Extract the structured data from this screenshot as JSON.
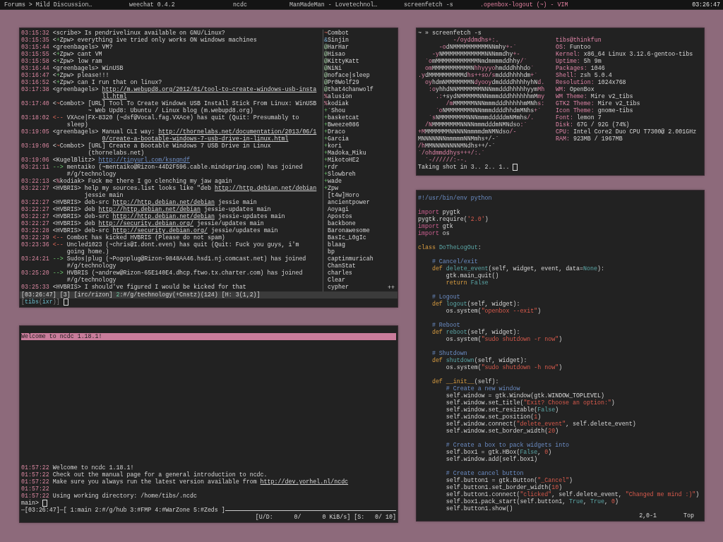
{
  "taskbar": {
    "tasks": [
      {
        "title": "Forums > Mild Discussion…",
        "selected": false
      },
      {
        "title": "weechat 0.4.2",
        "selected": false
      },
      {
        "title": "ncdc",
        "selected": false
      },
      {
        "title": "ManMadeMan - Lovetechnol…",
        "selected": false
      },
      {
        "title": "screenfetch -s",
        "selected": false
      },
      {
        "title": ".openbox-logout (~) - VIM",
        "selected": true
      }
    ],
    "clock": "03:26:47"
  },
  "weechat": {
    "messages": [
      {
        "time": "03:15:32",
        "prefix": [
          {
            "kind": "plain",
            "text": "<scribe>"
          }
        ],
        "lines": [
          [
            {
              "kind": "plain",
              "text": "Is pendrivelinux available on GNU/Linux?"
            }
          ]
        ]
      },
      {
        "time": "03:15:35",
        "prefix": [
          {
            "kind": "plain",
            "text": "<"
          },
          {
            "kind": "voice",
            "text": "+"
          },
          {
            "kind": "plain",
            "text": "Zpw>"
          }
        ],
        "lines": [
          [
            {
              "kind": "plain",
              "text": "everything ive tried only works ON windows machines"
            }
          ]
        ]
      },
      {
        "time": "03:15:44",
        "prefix": [
          {
            "kind": "plain",
            "text": "<greenbagels>"
          }
        ],
        "lines": [
          [
            {
              "kind": "plain",
              "text": "VM?"
            }
          ]
        ]
      },
      {
        "time": "03:15:55",
        "prefix": [
          {
            "kind": "plain",
            "text": "<"
          },
          {
            "kind": "voice",
            "text": "+"
          },
          {
            "kind": "plain",
            "text": "Zpw>"
          }
        ],
        "lines": [
          [
            {
              "kind": "plain",
              "text": "cant VM"
            }
          ]
        ]
      },
      {
        "time": "03:15:58",
        "prefix": [
          {
            "kind": "plain",
            "text": "<"
          },
          {
            "kind": "voice",
            "text": "+"
          },
          {
            "kind": "plain",
            "text": "Zpw>"
          }
        ],
        "lines": [
          [
            {
              "kind": "plain",
              "text": "low ram"
            }
          ]
        ]
      },
      {
        "time": "03:16:44",
        "prefix": [
          {
            "kind": "plain",
            "text": "<greenbagels>"
          }
        ],
        "lines": [
          [
            {
              "kind": "plain",
              "text": "WinUSB"
            }
          ]
        ]
      },
      {
        "time": "03:16:47",
        "prefix": [
          {
            "kind": "plain",
            "text": "<"
          },
          {
            "kind": "voice",
            "text": "+"
          },
          {
            "kind": "plain",
            "text": "Zpw>"
          }
        ],
        "lines": [
          [
            {
              "kind": "plain",
              "text": "please!!!"
            }
          ]
        ]
      },
      {
        "time": "03:16:52",
        "prefix": [
          {
            "kind": "plain",
            "text": "<"
          },
          {
            "kind": "voice",
            "text": "+"
          },
          {
            "kind": "plain",
            "text": "Zpw>"
          }
        ],
        "lines": [
          [
            {
              "kind": "plain",
              "text": "can I run that on linux?"
            }
          ]
        ]
      },
      {
        "time": "03:17:38",
        "prefix": [
          {
            "kind": "plain",
            "text": "<greenbagels>"
          }
        ],
        "lines": [
          [
            {
              "kind": "link",
              "text": "http://m.webupd8.org/2012/01/tool-to-create-windows-usb-insta"
            }
          ],
          [
            {
              "kind": "link",
              "text": "ll.html"
            }
          ]
        ]
      },
      {
        "time": "03:17:40",
        "prefix": [
          {
            "kind": "plain",
            "text": "<"
          },
          {
            "kind": "owner",
            "text": "~"
          },
          {
            "kind": "plain",
            "text": "Combot>"
          }
        ],
        "lines": [
          [
            {
              "kind": "plain",
              "text": "[URL] Tool To Create Windows USB Install Stick From Linux: WinUSB"
            }
          ],
          [
            {
              "kind": "plain",
              "text": "~ Web Upd8: Ubuntu / Linux blog (m.webupd8.org)"
            }
          ]
        ]
      },
      {
        "time": "03:18:02",
        "prefix": [
          {
            "kind": "quit",
            "text": "<--"
          }
        ],
        "lines": [
          [
            {
              "kind": "plain",
              "text": "VXAce|FX-8320 (~dsf@Vocal.fag.VXAce) has quit (Quit: Presumably to"
            }
          ],
          [
            {
              "kind": "plain",
              "text": "sleep)"
            }
          ]
        ]
      },
      {
        "time": "03:19:05",
        "prefix": [
          {
            "kind": "plain",
            "text": "<greenbagels>"
          }
        ],
        "lines": [
          [
            {
              "kind": "plain",
              "text": "Manual CLI way: "
            },
            {
              "kind": "link",
              "text": "http://thornelabs.net/documentation/2013/06/1"
            }
          ],
          [
            {
              "kind": "link",
              "text": "0/create-a-bootable-windows-7-usb-drive-in-linux.html"
            }
          ]
        ]
      },
      {
        "time": "03:19:06",
        "prefix": [
          {
            "kind": "plain",
            "text": "<"
          },
          {
            "kind": "owner",
            "text": "~"
          },
          {
            "kind": "plain",
            "text": "Combot>"
          }
        ],
        "lines": [
          [
            {
              "kind": "plain",
              "text": "[URL] Create a Bootable Windows 7 USB Drive in Linux"
            }
          ],
          [
            {
              "kind": "plain",
              "text": "(thornelabs.net)"
            }
          ]
        ]
      },
      {
        "time": "03:19:06",
        "prefix": [
          {
            "kind": "plain",
            "text": "<KugelBlitz>"
          }
        ],
        "lines": [
          [
            {
              "kind": "url",
              "text": "http://tinyurl.com/ksngndf"
            }
          ]
        ]
      },
      {
        "time": "03:21:11",
        "prefix": [
          {
            "kind": "join",
            "text": "-->"
          }
        ],
        "lines": [
          [
            {
              "kind": "plain",
              "text": "mentaiko (~mentaiko@Rizon-44D2F596.cable.mindspring.com) has joined"
            }
          ],
          [
            {
              "kind": "plain",
              "text": "#/g/technology"
            }
          ]
        ]
      },
      {
        "time": "03:22:13",
        "prefix": [
          {
            "kind": "plain",
            "text": "<"
          },
          {
            "kind": "halfop",
            "text": "%"
          },
          {
            "kind": "plain",
            "text": "kodiak>"
          }
        ],
        "lines": [
          [
            {
              "kind": "plain",
              "text": "Fuck me there I go clenching my jaw again"
            }
          ]
        ]
      },
      {
        "time": "03:22:27",
        "prefix": [
          {
            "kind": "plain",
            "text": "<HVBRIS>"
          }
        ],
        "lines": [
          [
            {
              "kind": "plain",
              "text": "help my sources.list looks like \"deb "
            },
            {
              "kind": "link",
              "text": "http://http.debian.net/debian"
            }
          ],
          [
            {
              "kind": "plain",
              "text": "jessie main"
            }
          ]
        ]
      },
      {
        "time": "03:22:27",
        "prefix": [
          {
            "kind": "plain",
            "text": "<HVBRIS>"
          }
        ],
        "lines": [
          [
            {
              "kind": "plain",
              "text": "deb-src "
            },
            {
              "kind": "link",
              "text": "http://http.debian.net/debian"
            },
            {
              "kind": "plain",
              "text": " jessie main"
            }
          ]
        ]
      },
      {
        "time": "03:22:27",
        "prefix": [
          {
            "kind": "plain",
            "text": "<HVBRIS>"
          }
        ],
        "lines": [
          [
            {
              "kind": "plain",
              "text": "deb "
            },
            {
              "kind": "link",
              "text": "http://http.debian.net/debian"
            },
            {
              "kind": "plain",
              "text": " jessie-updates main"
            }
          ]
        ]
      },
      {
        "time": "03:22:27",
        "prefix": [
          {
            "kind": "plain",
            "text": "<HVBRIS>"
          }
        ],
        "lines": [
          [
            {
              "kind": "plain",
              "text": "deb-src "
            },
            {
              "kind": "link",
              "text": "http://http.debian.net/debian"
            },
            {
              "kind": "plain",
              "text": " jessie-updates main"
            }
          ]
        ]
      },
      {
        "time": "03:22:27",
        "prefix": [
          {
            "kind": "plain",
            "text": "<HVBRIS>"
          }
        ],
        "lines": [
          [
            {
              "kind": "plain",
              "text": "deb "
            },
            {
              "kind": "link",
              "text": "http://security.debian.org/"
            },
            {
              "kind": "plain",
              "text": " jessie/updates main"
            }
          ]
        ]
      },
      {
        "time": "03:22:28",
        "prefix": [
          {
            "kind": "plain",
            "text": "<HVBRIS>"
          }
        ],
        "lines": [
          [
            {
              "kind": "plain",
              "text": "deb-src "
            },
            {
              "kind": "link",
              "text": "http://security.debian.org/"
            },
            {
              "kind": "plain",
              "text": " jessie/updates main"
            }
          ]
        ]
      },
      {
        "time": "03:22:29",
        "prefix": [
          {
            "kind": "quit",
            "text": "<--"
          }
        ],
        "lines": [
          [
            {
              "kind": "plain",
              "text": "Combot has kicked HVBRIS (Please do not spam)"
            }
          ]
        ]
      },
      {
        "time": "03:23:36",
        "prefix": [
          {
            "kind": "quit",
            "text": "<--"
          }
        ],
        "lines": [
          [
            {
              "kind": "plain",
              "text": "Uncled1023 (~chris@I.dont.even) has quit (Quit: Fuck you guys, i'm"
            }
          ],
          [
            {
              "kind": "plain",
              "text": "going home.)"
            }
          ]
        ]
      },
      {
        "time": "03:24:21",
        "prefix": [
          {
            "kind": "join",
            "text": "-->"
          }
        ],
        "lines": [
          [
            {
              "kind": "plain",
              "text": "Sudos|plug (~Pogoplug@Rizon-9848AA46.hsd1.nj.comcast.net) has joined"
            }
          ],
          [
            {
              "kind": "plain",
              "text": "#/g/technology"
            }
          ]
        ]
      },
      {
        "time": "03:25:20",
        "prefix": [
          {
            "kind": "join",
            "text": "-->"
          }
        ],
        "lines": [
          [
            {
              "kind": "plain",
              "text": "HVBRIS (~andrew@Rizon-65E140E4.dhcp.ftwo.tx.charter.com) has joined"
            }
          ],
          [
            {
              "kind": "plain",
              "text": "#/g/technology"
            }
          ]
        ]
      },
      {
        "time": "03:25:33",
        "prefix": [
          {
            "kind": "plain",
            "text": "<HVBRIS>"
          }
        ],
        "lines": [
          [
            {
              "kind": "plain",
              "text": "I should've figured I would be kicked for that"
            }
          ]
        ]
      }
    ],
    "nicklist": [
      {
        "kind": "owner",
        "prefix": "~",
        "nick": "Combot"
      },
      {
        "kind": "admin",
        "prefix": "&",
        "nick": "Sinjin"
      },
      {
        "kind": "op",
        "prefix": "@",
        "nick": "HarHar"
      },
      {
        "kind": "op",
        "prefix": "@",
        "nick": "Hisao"
      },
      {
        "kind": "op",
        "prefix": "@",
        "nick": "KittyKatt"
      },
      {
        "kind": "op",
        "prefix": "@",
        "nick": "NiNi"
      },
      {
        "kind": "op",
        "prefix": "@",
        "nick": "noface|sleep"
      },
      {
        "kind": "op",
        "prefix": "@",
        "nick": "Pr0Wolf29"
      },
      {
        "kind": "op",
        "prefix": "@",
        "nick": "that4chanwolf"
      },
      {
        "kind": "halfop",
        "prefix": "%",
        "nick": "alusion"
      },
      {
        "kind": "halfop",
        "prefix": "%",
        "nick": "kodiak"
      },
      {
        "kind": "voice",
        "prefix": "+",
        "nick": "`Shou"
      },
      {
        "kind": "voice",
        "prefix": "+",
        "nick": "basketcat"
      },
      {
        "kind": "voice",
        "prefix": "+",
        "nick": "Bweeze086"
      },
      {
        "kind": "voice",
        "prefix": "+",
        "nick": "Draco"
      },
      {
        "kind": "voice",
        "prefix": "+",
        "nick": "Garcia"
      },
      {
        "kind": "voice",
        "prefix": "+",
        "nick": "kori"
      },
      {
        "kind": "voice",
        "prefix": "+",
        "nick": "Madoka_Miku"
      },
      {
        "kind": "voice",
        "prefix": "+",
        "nick": "MikotoHE2"
      },
      {
        "kind": "voice",
        "prefix": "+",
        "nick": "rdr"
      },
      {
        "kind": "voice",
        "prefix": "+",
        "nick": "Slowbreh"
      },
      {
        "kind": "voice",
        "prefix": "+",
        "nick": "wade"
      },
      {
        "kind": "voice",
        "prefix": "+",
        "nick": "Zpw"
      },
      {
        "kind": "regular",
        "nick": "[t4w]Horo"
      },
      {
        "kind": "regular",
        "nick": "ancientpower"
      },
      {
        "kind": "regular",
        "nick": "Aoyagi"
      },
      {
        "kind": "regular",
        "nick": "Apostos"
      },
      {
        "kind": "regular",
        "nick": "backbone"
      },
      {
        "kind": "regular",
        "nick": "Baronawesome"
      },
      {
        "kind": "regular",
        "nick": "BasIc_L0gIc"
      },
      {
        "kind": "regular",
        "nick": "blaag"
      },
      {
        "kind": "regular",
        "nick": "bp"
      },
      {
        "kind": "regular",
        "nick": "captinmuricah"
      },
      {
        "kind": "regular",
        "nick": "ChanStat"
      },
      {
        "kind": "regular",
        "nick": "charles"
      },
      {
        "kind": "regular",
        "nick": "Clear"
      },
      {
        "kind": "regular",
        "nick": "cypher"
      }
    ],
    "nicklist_more": "++",
    "status_bar": [
      {
        "kind": "plain",
        "text": "[03:26:47] [3] [irc/rizon] "
      },
      {
        "kind": "channel",
        "text": "2"
      },
      {
        "kind": "plain",
        "text": ":#/g/technology(+Cnstz)(124) [H: 3(1,2)]"
      }
    ],
    "input_prompt": [
      {
        "kind": "dim",
        "text": "["
      },
      {
        "kind": "user",
        "text": "tibs"
      },
      {
        "kind": "dim",
        "text": "("
      },
      {
        "kind": "user",
        "text": "ixr"
      },
      {
        "kind": "dim",
        "text": ")]"
      }
    ]
  },
  "ncdc": {
    "title": "Welcome to ncdc 1.18.1!",
    "log": [
      {
        "time": "01:57:22",
        "spans": [
          {
            "kind": "plain",
            "text": "Welcome to ncdc 1.18.1!"
          }
        ]
      },
      {
        "time": "01:57:22",
        "spans": [
          {
            "kind": "plain",
            "text": "Check out the manual page for a general introduction to ncdc."
          }
        ]
      },
      {
        "time": "01:57:22",
        "spans": [
          {
            "kind": "plain",
            "text": "Make sure you always run the latest version available from "
          },
          {
            "kind": "link",
            "text": "http://dev.yorhel.nl/ncdc"
          }
        ]
      },
      {
        "time": "01:57:22"
      },
      {
        "time": "01:57:22",
        "spans": [
          {
            "kind": "plain",
            "text": "Using working directory: /home/tibs/.ncdc"
          }
        ]
      }
    ],
    "prompt": "main>",
    "window_list": "─[03:26:47]─[ 1:main 2:#/g/hub 3:#FMP 4:#WarZone 5:#Zeds ]",
    "transfer_status": "[U/D:      0/      0 KiB/s] [S:   0/ 10]"
  },
  "screenfetch": {
    "command": "~ » screenfetch -s",
    "art": [
      [
        {
          "kind": "accent",
          "text": "          -/oyddmdhs+:."
        }
      ],
      [
        {
          "kind": "accent",
          "text": "      -o"
        },
        {
          "kind": "plain",
          "text": "dNMMMMMMMMMMNNmhy"
        },
        {
          "kind": "accent",
          "text": "+-`"
        }
      ],
      [
        {
          "kind": "accent",
          "text": "    -y"
        },
        {
          "kind": "plain",
          "text": "NMMMMMMMMMMMMNNNmmdhy"
        },
        {
          "kind": "accent",
          "text": "+-"
        }
      ],
      [
        {
          "kind": "accent",
          "text": "  `o"
        },
        {
          "kind": "plain",
          "text": "mMMMMMMMMMMMMNmdmmmmddhhy"
        },
        {
          "kind": "accent",
          "text": "/`"
        }
      ],
      [
        {
          "kind": "accent",
          "text": "  om"
        },
        {
          "kind": "plain",
          "text": "MMMMMMMMMMMN"
        },
        {
          "kind": "accent",
          "text": "hhyyyo"
        },
        {
          "kind": "plain",
          "text": "hmdddhhhdo"
        },
        {
          "kind": "accent",
          "text": "`"
        }
      ],
      [
        {
          "kind": "accent",
          "text": ".y"
        },
        {
          "kind": "plain",
          "text": "dMMMMMMMMMMd"
        },
        {
          "kind": "accent",
          "text": "hs++so/s"
        },
        {
          "kind": "plain",
          "text": "mdddhhhhdm"
        },
        {
          "kind": "accent",
          "text": "+`"
        }
      ],
      [
        {
          "kind": "accent",
          "text": "  oy"
        },
        {
          "kind": "plain",
          "text": "hdmNMMMMMMMN"
        },
        {
          "kind": "accent",
          "text": "dyooy"
        },
        {
          "kind": "plain",
          "text": "dmddddhhhhyhN"
        },
        {
          "kind": "accent",
          "text": "d."
        }
      ],
      [
        {
          "kind": "accent",
          "text": "   :o"
        },
        {
          "kind": "plain",
          "text": "yhhdNNMMMMMMMNNNmmdddhhhhhyym"
        },
        {
          "kind": "accent",
          "text": "Mh"
        }
      ],
      [
        {
          "kind": "accent",
          "text": "     .:"
        },
        {
          "kind": "plain",
          "text": "+sydNMMMMMNNNmmmdddhhhhhhmM"
        },
        {
          "kind": "accent",
          "text": "my"
        }
      ],
      [
        {
          "kind": "accent",
          "text": "        /m"
        },
        {
          "kind": "plain",
          "text": "MMMMMMNNNmmmdddhhhhhmMNh"
        },
        {
          "kind": "accent",
          "text": "s:"
        }
      ],
      [
        {
          "kind": "accent",
          "text": "     `o"
        },
        {
          "kind": "plain",
          "text": "NMMMMMMMNNNmmmddddhhdmMNhs"
        },
        {
          "kind": "accent",
          "text": "+`"
        }
      ],
      [
        {
          "kind": "accent",
          "text": "   `s"
        },
        {
          "kind": "plain",
          "text": "NMMMMMMMMNNNmmmdddddmNMmhs"
        },
        {
          "kind": "accent",
          "text": "/."
        }
      ],
      [
        {
          "kind": "accent",
          "text": "  /N"
        },
        {
          "kind": "plain",
          "text": "MMMMMMMMNNNNmmmdddmNMNdso"
        },
        {
          "kind": "accent",
          "text": ":`"
        }
      ],
      [
        {
          "kind": "accent",
          "text": "+M"
        },
        {
          "kind": "plain",
          "text": "MMMMMMMNNNNNmmmmdmNMNdso"
        },
        {
          "kind": "accent",
          "text": "/-"
        }
      ],
      [
        {
          "kind": "plain",
          "text": "MNNNNNNNmmmmmNNMmhs+/-`"
        }
      ],
      [
        {
          "kind": "accent",
          "text": "/h"
        },
        {
          "kind": "plain",
          "text": "MMNNNNNNNNMNdhs++/-`"
        }
      ],
      [
        {
          "kind": "accent",
          "text": "`/ohdmmddhys+++/:.`"
        }
      ],
      [
        {
          "kind": "accent",
          "text": "  `-//////:--."
        }
      ]
    ],
    "user": "tibs@thinkfun",
    "info": [
      {
        "label": "OS:",
        "value": "Funtoo"
      },
      {
        "label": "Kernel:",
        "value": "x86_64 Linux 3.12.6-gentoo-tibs"
      },
      {
        "label": "Uptime:",
        "value": "5h 9m"
      },
      {
        "label": "Packages:",
        "value": "1046"
      },
      {
        "label": "Shell:",
        "value": "zsh 5.0.4"
      },
      {
        "label": "Resolution:",
        "value": "1024x768"
      },
      {
        "label": "WM:",
        "value": "OpenBox"
      },
      {
        "label": "WM Theme:",
        "value": "Mire v2_tibs"
      },
      {
        "label": "GTK2 Theme:",
        "value": "Mire v2_tibs"
      },
      {
        "label": "Icon Theme:",
        "value": "gnome-tibs"
      },
      {
        "label": "Font:",
        "value": "lemon 7"
      },
      {
        "label": "Disk:",
        "value": "67G / 92G (74%)"
      },
      {
        "label": "CPU:",
        "value": "Intel Core2 Duo CPU T7300@ 2.001GHz"
      },
      {
        "label": "RAM:",
        "value": "923MB / 1967MB"
      }
    ],
    "output": "Taking shot in 3.. 2.. 1.."
  },
  "vim": {
    "lines": [
      {
        "kind": "code",
        "spans": [
          {
            "kind": "comment",
            "text": "#!/usr/bin/env python"
          }
        ]
      },
      {
        "kind": "blank"
      },
      {
        "kind": "code",
        "spans": [
          {
            "kind": "keyword",
            "text": "import"
          },
          {
            "kind": "plain",
            "text": " pygtk"
          }
        ]
      },
      {
        "kind": "code",
        "spans": [
          {
            "kind": "plain",
            "text": "pygtk.require("
          },
          {
            "kind": "string",
            "text": "'2.0'"
          },
          {
            "kind": "plain",
            "text": ")"
          }
        ]
      },
      {
        "kind": "code",
        "spans": [
          {
            "kind": "keyword",
            "text": "import"
          },
          {
            "kind": "plain",
            "text": " gtk"
          }
        ]
      },
      {
        "kind": "code",
        "spans": [
          {
            "kind": "keyword",
            "text": "import"
          },
          {
            "kind": "plain",
            "text": " os"
          }
        ]
      },
      {
        "kind": "blank"
      },
      {
        "kind": "code",
        "spans": [
          {
            "kind": "statement",
            "text": "class"
          },
          {
            "kind": "function",
            "text": " DoTheLogOut"
          },
          {
            "kind": "plain",
            "text": ":"
          }
        ]
      },
      {
        "kind": "blank"
      },
      {
        "kind": "code",
        "spans": [
          {
            "kind": "comment",
            "text": "    # Cancel/exit"
          }
        ]
      },
      {
        "kind": "code",
        "spans": [
          {
            "kind": "statement",
            "text": "    def"
          },
          {
            "kind": "function",
            "text": " delete_event"
          },
          {
            "kind": "plain",
            "text": "(self, widget, event, data="
          },
          {
            "kind": "constant",
            "text": "None"
          },
          {
            "kind": "plain",
            "text": "):"
          }
        ]
      },
      {
        "kind": "code",
        "spans": [
          {
            "kind": "plain",
            "text": "        gtk.main_quit()"
          }
        ]
      },
      {
        "kind": "code",
        "spans": [
          {
            "kind": "statement",
            "text": "        return"
          },
          {
            "kind": "constant",
            "text": " False"
          }
        ]
      },
      {
        "kind": "blank"
      },
      {
        "kind": "code",
        "spans": [
          {
            "kind": "comment",
            "text": "    # Logout"
          }
        ]
      },
      {
        "kind": "code",
        "spans": [
          {
            "kind": "statement",
            "text": "    def"
          },
          {
            "kind": "function",
            "text": " logout"
          },
          {
            "kind": "plain",
            "text": "(self, widget):"
          }
        ]
      },
      {
        "kind": "code",
        "spans": [
          {
            "kind": "plain",
            "text": "        os.system("
          },
          {
            "kind": "string",
            "text": "\"openbox --exit\""
          },
          {
            "kind": "plain",
            "text": ")"
          }
        ]
      },
      {
        "kind": "blank"
      },
      {
        "kind": "code",
        "spans": [
          {
            "kind": "comment",
            "text": "    # Reboot"
          }
        ]
      },
      {
        "kind": "code",
        "spans": [
          {
            "kind": "statement",
            "text": "    def"
          },
          {
            "kind": "function",
            "text": " reboot"
          },
          {
            "kind": "plain",
            "text": "(self, widget):"
          }
        ]
      },
      {
        "kind": "code",
        "spans": [
          {
            "kind": "plain",
            "text": "        os.system("
          },
          {
            "kind": "string",
            "text": "\"sudo shutdown -r now\""
          },
          {
            "kind": "plain",
            "text": ")"
          }
        ]
      },
      {
        "kind": "blank"
      },
      {
        "kind": "code",
        "spans": [
          {
            "kind": "comment",
            "text": "    # Shutdown"
          }
        ]
      },
      {
        "kind": "code",
        "spans": [
          {
            "kind": "statement",
            "text": "    def"
          },
          {
            "kind": "function",
            "text": " shutdown"
          },
          {
            "kind": "plain",
            "text": "(self, widget):"
          }
        ]
      },
      {
        "kind": "code",
        "spans": [
          {
            "kind": "plain",
            "text": "        os.system("
          },
          {
            "kind": "string",
            "text": "\"sudo shutdown -h now\""
          },
          {
            "kind": "plain",
            "text": ")"
          }
        ]
      },
      {
        "kind": "blank"
      },
      {
        "kind": "code",
        "spans": [
          {
            "kind": "statement",
            "text": "    def __init__"
          },
          {
            "kind": "plain",
            "text": "(self):"
          }
        ]
      },
      {
        "kind": "code",
        "spans": [
          {
            "kind": "comment",
            "text": "        # Create a new window"
          }
        ]
      },
      {
        "kind": "code",
        "spans": [
          {
            "kind": "plain",
            "text": "        self.window = gtk.Window(gtk.WINDOW_TOPLEVEL)"
          }
        ]
      },
      {
        "kind": "code",
        "spans": [
          {
            "kind": "plain",
            "text": "        self.window.set_title("
          },
          {
            "kind": "string",
            "text": "\"Exit? Choose an option:\""
          },
          {
            "kind": "plain",
            "text": ")"
          }
        ]
      },
      {
        "kind": "code",
        "spans": [
          {
            "kind": "plain",
            "text": "        self.window.set_resizable("
          },
          {
            "kind": "constant",
            "text": "False"
          },
          {
            "kind": "plain",
            "text": ")"
          }
        ]
      },
      {
        "kind": "code",
        "spans": [
          {
            "kind": "plain",
            "text": "        self.window.set_position("
          },
          {
            "kind": "number",
            "text": "1"
          },
          {
            "kind": "plain",
            "text": ")"
          }
        ]
      },
      {
        "kind": "code",
        "spans": [
          {
            "kind": "plain",
            "text": "        self.window.connect("
          },
          {
            "kind": "string",
            "text": "\"delete_event\""
          },
          {
            "kind": "plain",
            "text": ", self.delete_event)"
          }
        ]
      },
      {
        "kind": "code",
        "spans": [
          {
            "kind": "plain",
            "text": "        self.window.set_border_width("
          },
          {
            "kind": "number",
            "text": "20"
          },
          {
            "kind": "plain",
            "text": ")"
          }
        ]
      },
      {
        "kind": "blank"
      },
      {
        "kind": "code",
        "spans": [
          {
            "kind": "comment",
            "text": "        # Create a box to pack widgets into"
          }
        ]
      },
      {
        "kind": "code",
        "spans": [
          {
            "kind": "plain",
            "text": "        self.box1 = gtk.HBox("
          },
          {
            "kind": "constant",
            "text": "False"
          },
          {
            "kind": "plain",
            "text": ", "
          },
          {
            "kind": "number",
            "text": "0"
          },
          {
            "kind": "plain",
            "text": ")"
          }
        ]
      },
      {
        "kind": "code",
        "spans": [
          {
            "kind": "plain",
            "text": "        self.window.add(self.box1)"
          }
        ]
      },
      {
        "kind": "blank"
      },
      {
        "kind": "code",
        "spans": [
          {
            "kind": "comment",
            "text": "        # Create cancel button"
          }
        ]
      },
      {
        "kind": "code",
        "spans": [
          {
            "kind": "plain",
            "text": "        self.button1 = gtk.Button("
          },
          {
            "kind": "string",
            "text": "\"_Cancel\""
          },
          {
            "kind": "plain",
            "text": ")"
          }
        ]
      },
      {
        "kind": "code",
        "spans": [
          {
            "kind": "plain",
            "text": "        self.button1.set_border_width("
          },
          {
            "kind": "number",
            "text": "10"
          },
          {
            "kind": "plain",
            "text": ")"
          }
        ]
      },
      {
        "kind": "code",
        "spans": [
          {
            "kind": "plain",
            "text": "        self.button1.connect("
          },
          {
            "kind": "string",
            "text": "\"clicked\""
          },
          {
            "kind": "plain",
            "text": ", self.delete_event, "
          },
          {
            "kind": "string",
            "text": "\"Changed me mind :)\""
          },
          {
            "kind": "plain",
            "text": ")"
          }
        ]
      },
      {
        "kind": "code",
        "spans": [
          {
            "kind": "plain",
            "text": "        self.box1.pack_start(self.button1, "
          },
          {
            "kind": "constant",
            "text": "True"
          },
          {
            "kind": "plain",
            "text": ", "
          },
          {
            "kind": "constant",
            "text": "True"
          },
          {
            "kind": "plain",
            "text": ", "
          },
          {
            "kind": "number",
            "text": "0"
          },
          {
            "kind": "plain",
            "text": ")"
          }
        ]
      },
      {
        "kind": "code",
        "spans": [
          {
            "kind": "plain",
            "text": "        self.button1.show()"
          }
        ]
      }
    ],
    "ruler": "2,0-1",
    "scroll_position": "Top"
  }
}
